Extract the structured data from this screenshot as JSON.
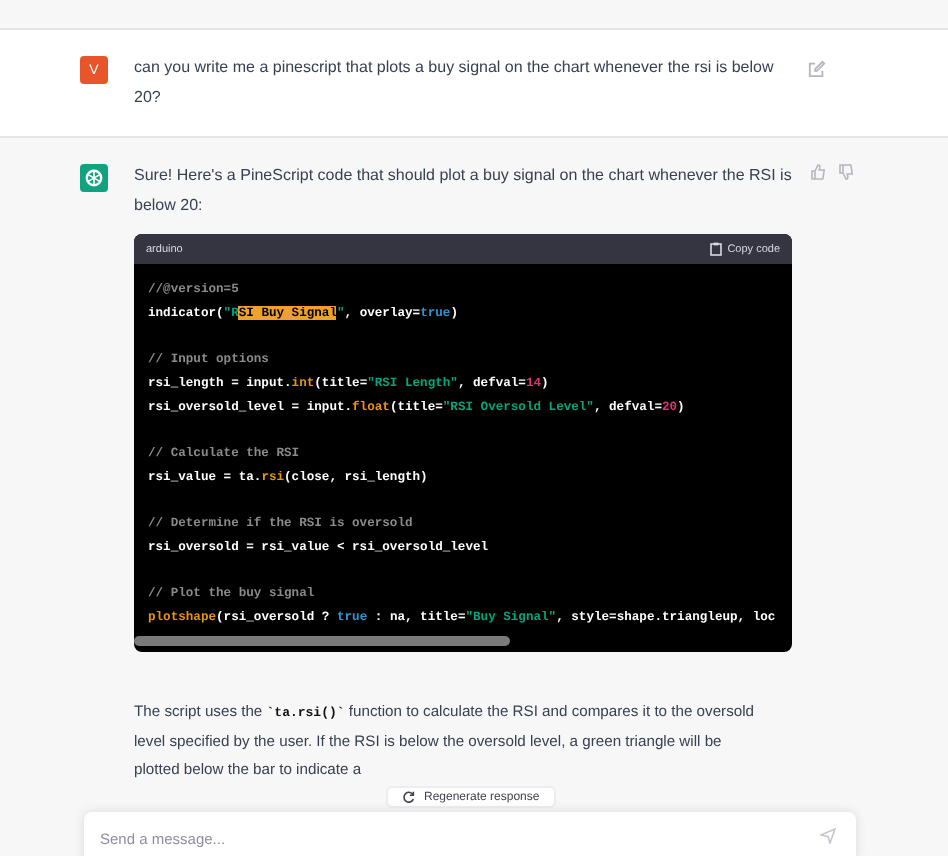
{
  "user_message": {
    "avatar": "V",
    "text": "can you write me a pinescript that plots a buy signal on the chart whenever the rsi is below 20?"
  },
  "assistant_message": {
    "intro": "Sure! Here's a PineScript code that should plot a buy signal on the chart whenever the RSI is below 20:",
    "code_block": {
      "language": "arduino",
      "copy_label": "Copy code",
      "blocks": [
        [
          [
            {
              "kind": "comment",
              "text": "//@version=5"
            }
          ],
          [
            {
              "kind": "plain",
              "text": "indicator("
            },
            {
              "kind": "string",
              "text": "\"R"
            },
            {
              "kind": "highlight",
              "text": "SI Buy Signal"
            },
            {
              "kind": "string",
              "text": "\""
            },
            {
              "kind": "plain",
              "text": ", overlay="
            },
            {
              "kind": "keyword",
              "text": "true"
            },
            {
              "kind": "plain",
              "text": ")"
            }
          ]
        ],
        [
          [
            {
              "kind": "comment",
              "text": "// Input options"
            }
          ],
          [
            {
              "kind": "plain",
              "text": "rsi_length = input."
            },
            {
              "kind": "builtin",
              "text": "int"
            },
            {
              "kind": "plain",
              "text": "(title="
            },
            {
              "kind": "string",
              "text": "\"RSI Length\""
            },
            {
              "kind": "plain",
              "text": ", defval="
            },
            {
              "kind": "number",
              "text": "14"
            },
            {
              "kind": "plain",
              "text": ")"
            }
          ],
          [
            {
              "kind": "plain",
              "text": "rsi_oversold_level = input."
            },
            {
              "kind": "builtin",
              "text": "float"
            },
            {
              "kind": "plain",
              "text": "(title="
            },
            {
              "kind": "string",
              "text": "\"RSI Oversold Level\""
            },
            {
              "kind": "plain",
              "text": ", defval="
            },
            {
              "kind": "number",
              "text": "20"
            },
            {
              "kind": "plain",
              "text": ")"
            }
          ]
        ],
        [
          [
            {
              "kind": "comment",
              "text": "// Calculate the RSI"
            }
          ],
          [
            {
              "kind": "plain",
              "text": "rsi_value = ta."
            },
            {
              "kind": "builtin",
              "text": "rsi"
            },
            {
              "kind": "plain",
              "text": "(close, rsi_length)"
            }
          ]
        ],
        [
          [
            {
              "kind": "comment",
              "text": "// Determine if the RSI is oversold"
            }
          ],
          [
            {
              "kind": "plain",
              "text": "rsi_oversold = rsi_value < rsi_oversold_level"
            }
          ]
        ],
        [
          [
            {
              "kind": "comment",
              "text": "// Plot the buy signal"
            }
          ],
          [
            {
              "kind": "builtin",
              "text": "plotshape"
            },
            {
              "kind": "plain",
              "text": "(rsi_oversold ? "
            },
            {
              "kind": "keyword",
              "text": "true"
            },
            {
              "kind": "plain",
              "text": " : na, title="
            },
            {
              "kind": "string",
              "text": "\"Buy Signal\""
            },
            {
              "kind": "plain",
              "text": ", style=shape.triangleup, loc"
            }
          ]
        ]
      ]
    },
    "outro": "The script uses the **`ta.rsi()`** function to calculate the RSI and compares it to the oversold level specified by the user. If the RSI is below the oversold level, a green triangle will be plotted below the bar to indicate a"
  },
  "regenerate_button": "Regenerate response",
  "composer": {
    "placeholder": "Send a message..."
  }
}
